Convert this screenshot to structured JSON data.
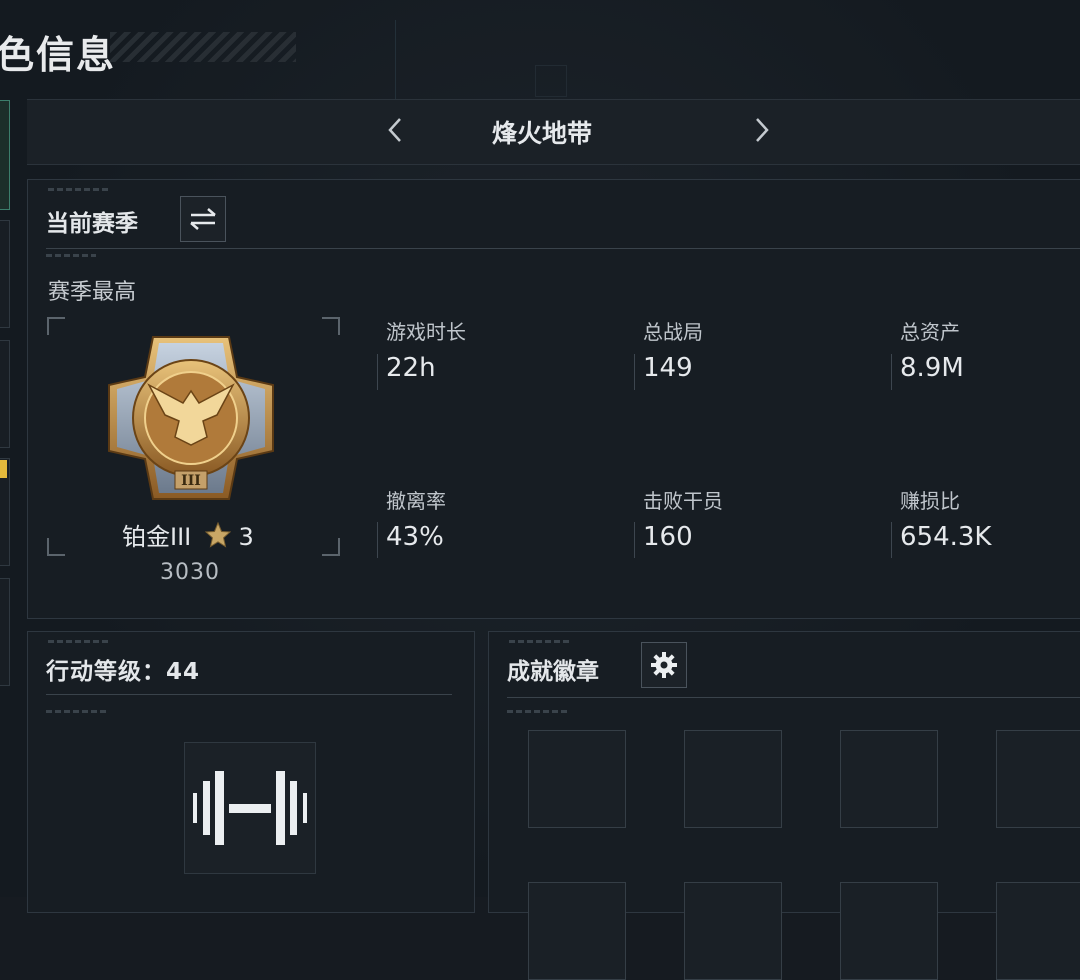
{
  "page": {
    "title": "色信息"
  },
  "game_switcher": {
    "name": "烽火地带",
    "prev_icon": "chevron-left-icon",
    "next_icon": "chevron-right-icon"
  },
  "season": {
    "title": "当前赛季",
    "swap_icon": "swap-arrows-icon",
    "best_label": "赛季最高",
    "rank": {
      "name": "铂金III",
      "stars": "3",
      "score": "3030",
      "emblem_numeral": "III"
    },
    "stats": [
      {
        "label": "游戏时长",
        "value": "22h"
      },
      {
        "label": "总战局",
        "value": "149"
      },
      {
        "label": "总资产",
        "value": "8.9M"
      },
      {
        "label": "撤离率",
        "value": "43%"
      },
      {
        "label": "击败干员",
        "value": "160"
      },
      {
        "label": "赚损比",
        "value": "654.3K"
      }
    ]
  },
  "action_level": {
    "title": "行动等级：44",
    "icon": "dumbbell-icon"
  },
  "achievements": {
    "title": "成就徽章",
    "settings_icon": "gear-icon"
  },
  "colors": {
    "accent_gold": "#e3b93c",
    "accent_green": "#3c7f6c",
    "panel_bg": "#171d23"
  }
}
